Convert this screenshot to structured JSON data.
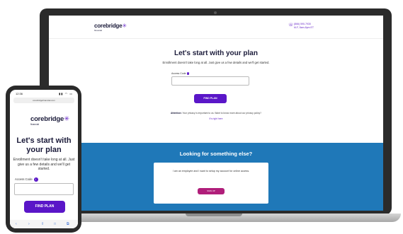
{
  "brand": {
    "name": "corebridge",
    "sub": "financial",
    "accent": "#5a16c8",
    "band_color": "#1f78b8",
    "secondary_button_color": "#b01e7a"
  },
  "laptop": {
    "contact": {
      "phone": "(866) 590-7930",
      "hours": "M-F, 8am-8pm ET"
    },
    "title": "Let's start with your plan",
    "subtitle": "Enrollment doesn't take long at all. Just give us a few details and we'll get started.",
    "access_label": "Access Code",
    "access_placeholder": "",
    "find_plan": "FIND PLAN",
    "attention_label": "Attention:",
    "attention_text": "Your privacy is important to us. Want to know more about our privacy policy?",
    "attention_link": "It's right here",
    "band_title": "Looking for something else?",
    "card_text": "I am an employee and I want to setup my account for online access.",
    "card_button": "SIGN UP"
  },
  "phone": {
    "time": "12:36",
    "signal": "▮▮ ◠ ▭",
    "url": "corebridgefinancial.com",
    "title": "Let's start with your plan",
    "subtitle": "Enrollment doesn't take long at all. Just give us a few details and we'll get started.",
    "access_label": "Access Code",
    "access_placeholder": "",
    "find_plan": "FIND PLAN",
    "nav": [
      "‹",
      "›",
      "⇧",
      "□",
      "⧉"
    ]
  }
}
